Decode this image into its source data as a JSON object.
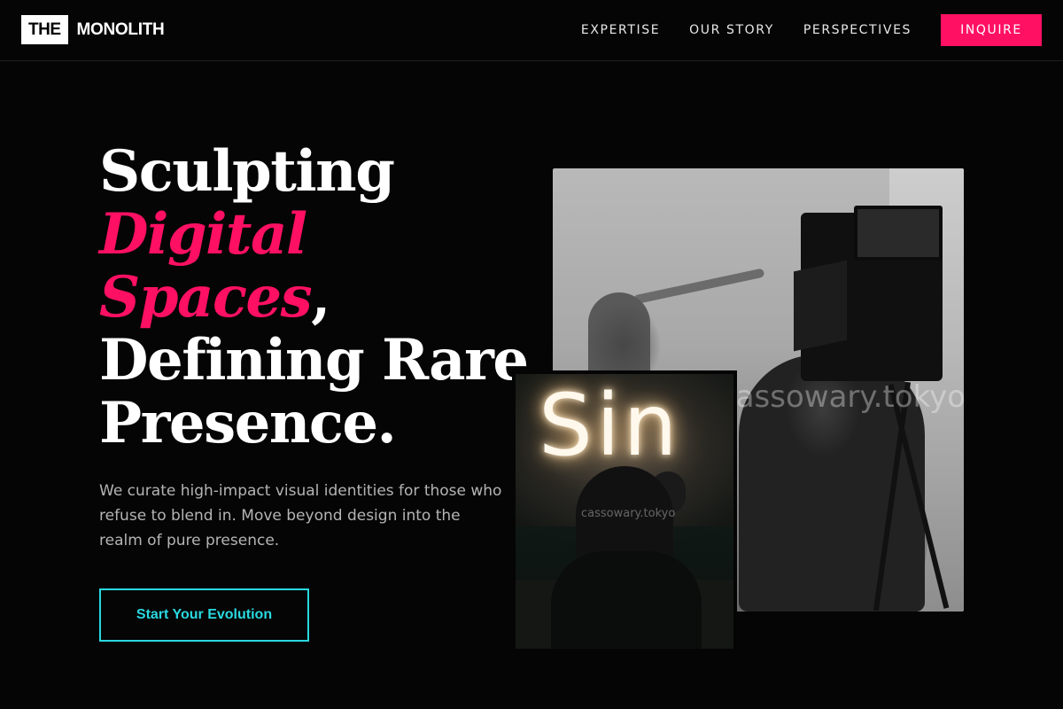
{
  "header": {
    "logo_box": "THE",
    "logo_word": "MONOLITH",
    "nav": [
      {
        "label": "EXPERTISE"
      },
      {
        "label": "OUR STORY"
      },
      {
        "label": "PERSPECTIVES"
      }
    ],
    "inquire_label": "INQUIRE"
  },
  "hero": {
    "headline": {
      "line1": "Sculpting",
      "line2_accent": "Digital",
      "line3_accent": "Spaces",
      "line3_suffix": ",",
      "line4": "Defining Rare",
      "line5": "Presence."
    },
    "subtext": "We curate high-impact visual identities for those who refuse to blend in. Move beyond design into the realm of pure presence.",
    "cta_label": "Start Your Evolution"
  },
  "images": {
    "back_watermark": "cassowary.tokyo",
    "front_neon_text": "Sin",
    "front_watermark": "cassowary.tokyo"
  },
  "colors": {
    "accent": "#ff1063",
    "cta": "#2ad8e0",
    "background": "#050505"
  }
}
